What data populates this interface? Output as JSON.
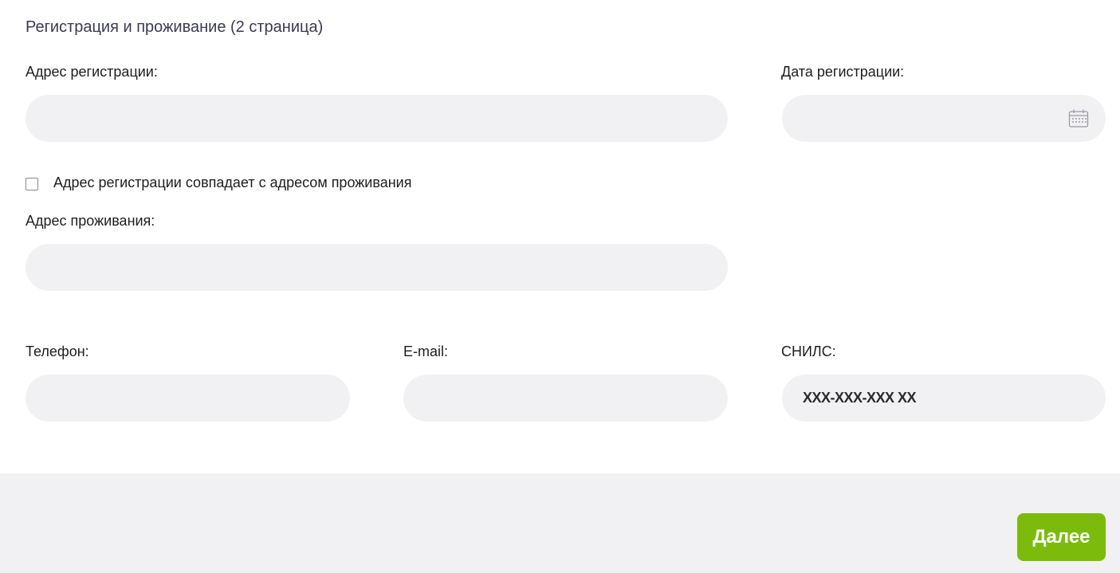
{
  "section": {
    "title": "Регистрация и проживание (2 страница)"
  },
  "registration": {
    "address_label": "Адрес регистрации:",
    "address_value": "",
    "date_label": "Дата регистрации:",
    "date_value": "",
    "date_icon": "calendar-icon"
  },
  "same_address": {
    "label": "Адрес регистрации совпадает с адресом проживания",
    "checked": false
  },
  "residence": {
    "address_label": "Адрес проживания:",
    "address_value": ""
  },
  "contacts": {
    "phone_label": "Телефон:",
    "phone_value": "",
    "email_label": "E-mail:",
    "email_value": "",
    "snils_label": "СНИЛС:",
    "snils_placeholder": "XXX-XXX-XXX XX"
  },
  "footer": {
    "next_label": "Далее",
    "next_color": "#7cbb0b"
  },
  "colors": {
    "field_bg": "#f1f1f3",
    "footer_bg": "#f1f1f3"
  }
}
